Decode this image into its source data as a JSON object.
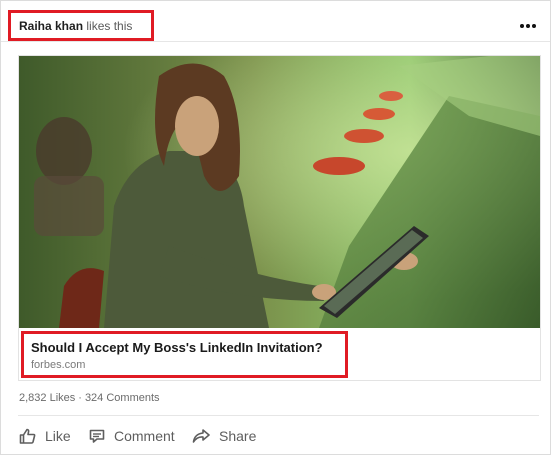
{
  "header": {
    "actor_name": "Raiha khan",
    "action_text": "likes this",
    "more_icon": "ellipsis-icon"
  },
  "article": {
    "title": "Should I Accept My Boss's LinkedIn Invitation?",
    "source": "forbes.com",
    "image_alt": "Woman using a tablet at a counter"
  },
  "social": {
    "likes": "2,832 Likes",
    "separator": "·",
    "comments": "324 Comments"
  },
  "actions": {
    "like_label": "Like",
    "comment_label": "Comment",
    "share_label": "Share"
  },
  "colors": {
    "highlight": "#e01b24",
    "text_primary": "#1a1a1a",
    "text_secondary": "#6b6b6b"
  }
}
